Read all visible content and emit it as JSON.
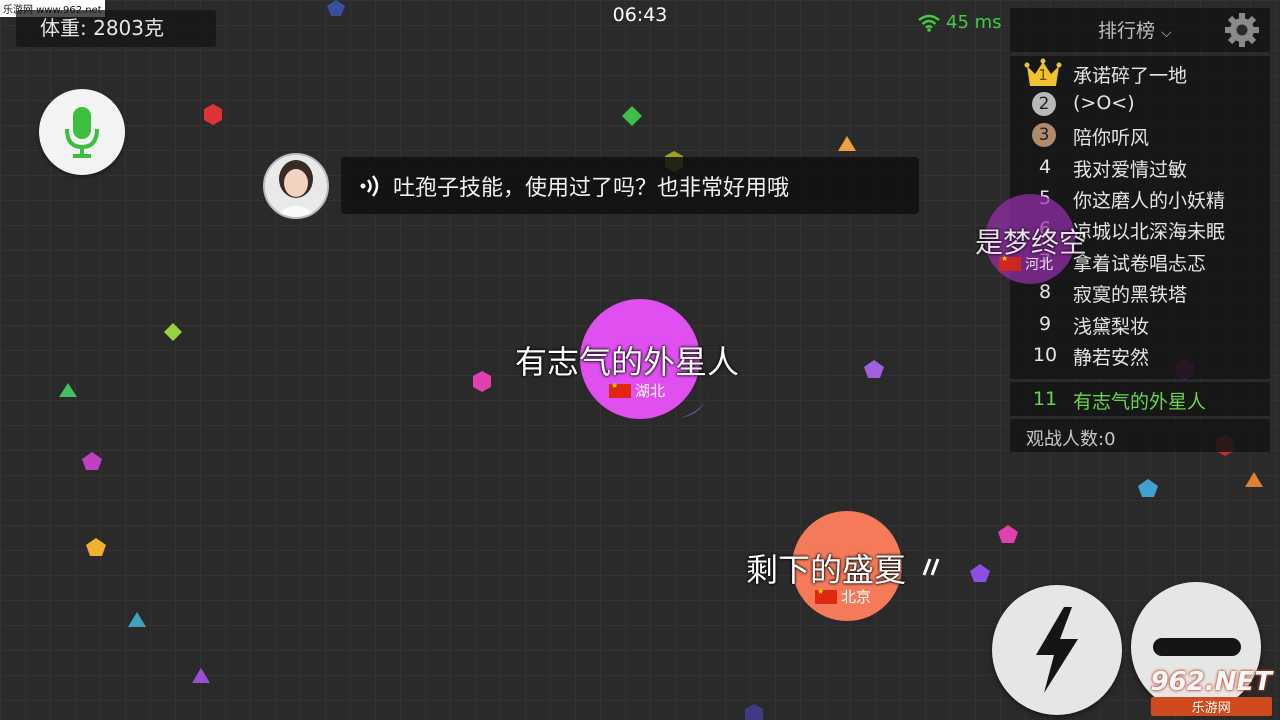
{
  "watermark_top": "乐游网 www.962.net",
  "hud": {
    "weight": "体重: 2803克",
    "clock": "06:43",
    "ping": "45 ms"
  },
  "chat": {
    "message": "吐孢子技能，使用过了吗？也非常好用哦"
  },
  "leaderboard": {
    "title": "排行榜",
    "entries": [
      {
        "rank": "1",
        "name": "承诺碎了一地"
      },
      {
        "rank": "2",
        "name": "(>O<)"
      },
      {
        "rank": "3",
        "name": "陪你听风"
      },
      {
        "rank": "4",
        "name": "我对爱情过敏"
      },
      {
        "rank": "5",
        "name": "你这磨人的小妖精"
      },
      {
        "rank": "6",
        "name": "凉城以北深海未眠"
      },
      {
        "rank": "7",
        "name": "拿着试卷唱忐忑"
      },
      {
        "rank": "8",
        "name": "寂寞的黑铁塔"
      },
      {
        "rank": "9",
        "name": "浅黛梨妆"
      },
      {
        "rank": "10",
        "name": "静若安然"
      }
    ],
    "self": {
      "rank": "11",
      "name": "有志气的外星人"
    },
    "spectators": "观战人数:0"
  },
  "cells": {
    "player": {
      "name": "有志气的外星人",
      "region": "湖北",
      "color": "#e04ff0"
    },
    "other1": {
      "name": "剩下的盛夏",
      "region": "北京",
      "color": "#f57a5a"
    },
    "other2": {
      "name": "是梦终空",
      "region": "河北",
      "color": "#9a2fb0"
    }
  },
  "watermark_bottom": {
    "brand": "962.NET",
    "sub": "乐游网"
  },
  "colors": {
    "accent_green": "#3fcf3f",
    "self_green": "#66d64a"
  }
}
